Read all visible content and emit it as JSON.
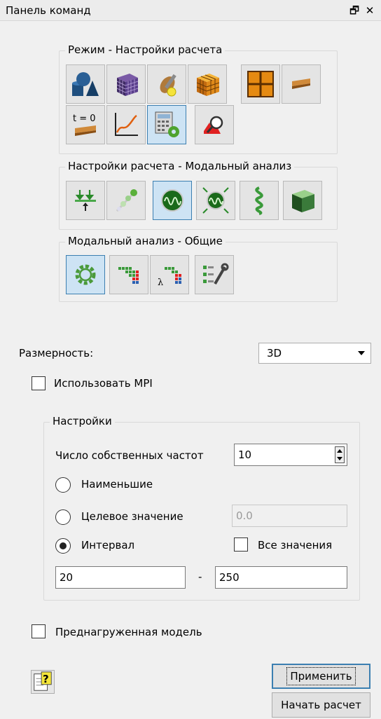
{
  "panel": {
    "title": "Панель команд",
    "float_glyph": "🗗",
    "close_glyph": "✕"
  },
  "groups": {
    "mode": {
      "title": "Режим - Настройки расчета"
    },
    "modal": {
      "title": "Настройки расчета - Модальный анализ"
    },
    "common": {
      "title": "Модальный анализ - Общие"
    }
  },
  "icons": {
    "mode_row1": [
      "geometry-primitives-icon",
      "mesh-cube-icon",
      "tools-wrench-icon",
      "material-cube-icon",
      "grid-partition-icon",
      "beam-section-icon"
    ],
    "mode_row2": [
      "initial-state-t0-icon",
      "graph-curve-icon",
      "calculator-settings-icon",
      "view-results-magnifier-icon"
    ],
    "mode_row2_text": "t = 0",
    "modal_row": [
      "boundary-conditions-icon",
      "beads-chain-icon",
      "mode-shape-icon",
      "mode-shape-load-icon",
      "spring-icon",
      "solid-block-icon"
    ],
    "common_row": [
      "gear-settings-icon",
      "matrix-dots-icon",
      "lambda-matrix-icon",
      "settings-sliders-wrench-icon"
    ],
    "common_row_lambda": "λ",
    "help_glyph": "?"
  },
  "dimension": {
    "label": "Размерность:",
    "value": "3D"
  },
  "use_mpi": {
    "label": "Использовать MPI",
    "checked": false
  },
  "settings": {
    "title": "Настройки",
    "eigen_count_label": "Число собственных частот",
    "eigen_count": "10",
    "smallest_label": "Наименьшие",
    "target_label": "Целевое значение",
    "target_value": "0.0",
    "interval_label": "Интервал",
    "all_values_label": "Все значения",
    "interval_from": "20",
    "interval_dash": "-",
    "interval_to": "250",
    "selected_mode": "interval"
  },
  "preloaded": {
    "label": "Преднагруженная модель",
    "checked": false
  },
  "buttons": {
    "apply": "Применить",
    "start": "Начать расчет"
  },
  "colors": {
    "active_accent": "#3c7fb1",
    "active_fill": "#cde3f4"
  }
}
